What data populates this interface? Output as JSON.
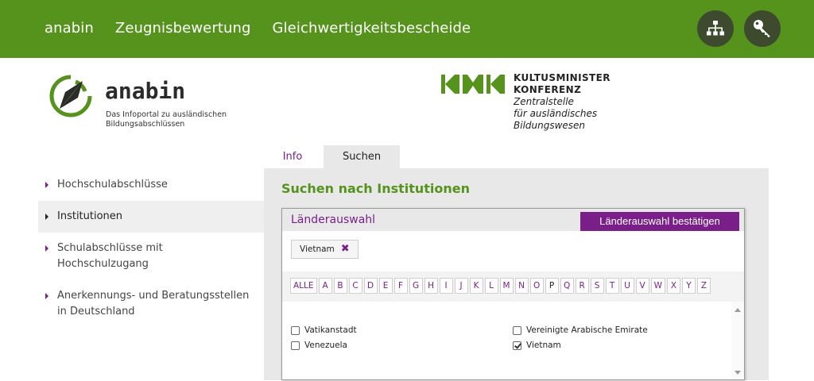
{
  "topnav": {
    "items": [
      "anabin",
      "Zeugnisbewertung",
      "Gleichwertigkeitsbescheide"
    ],
    "icons": [
      "sitemap-icon",
      "key-icon"
    ]
  },
  "logo_anabin": {
    "word": "anabin",
    "tagline_1": "Das Infoportal zu ausländischen",
    "tagline_2": "Bildungsabschlüssen"
  },
  "logo_kmk": {
    "line1": "KULTUSMINISTER",
    "line2": "KONFERENZ",
    "line3": "Zentralstelle",
    "line4": "für ausländisches",
    "line5": "Bildungswesen"
  },
  "sidebar": {
    "items": [
      {
        "label": "Hochschulabschlüsse",
        "active": false
      },
      {
        "label": "Institutionen",
        "active": true
      },
      {
        "label": "Schulabschlüsse mit Hochschulzugang",
        "active": false
      },
      {
        "label": "Anerkennungs- und Beratungsstellen in Deutschland",
        "active": false
      }
    ]
  },
  "tabs": {
    "info": "Info",
    "suchen": "Suchen"
  },
  "main": {
    "heading": "Suchen nach Institutionen"
  },
  "dialog": {
    "title": "Länderauswahl",
    "confirm_label": "Länderauswahl bestätigen",
    "selected_chip": "Vietnam",
    "chip_remove": "✖",
    "letters": [
      "ALLE",
      "A",
      "B",
      "C",
      "D",
      "E",
      "F",
      "G",
      "H",
      "I",
      "J",
      "K",
      "L",
      "M",
      "N",
      "O",
      "P",
      "Q",
      "R",
      "S",
      "T",
      "U",
      "V",
      "W",
      "X",
      "Y",
      "Z"
    ],
    "current_letter": "P",
    "countries": [
      {
        "name": "Vatikanstadt",
        "checked": false
      },
      {
        "name": "Venezuela",
        "checked": false
      },
      {
        "name": "Vereinigte Arabische Emirate",
        "checked": false
      },
      {
        "name": "Vietnam",
        "checked": true
      }
    ]
  },
  "colors": {
    "brand_green": "#55931c",
    "accent_purple": "#7a1f8a",
    "panel_gray": "#e8e8e8"
  }
}
